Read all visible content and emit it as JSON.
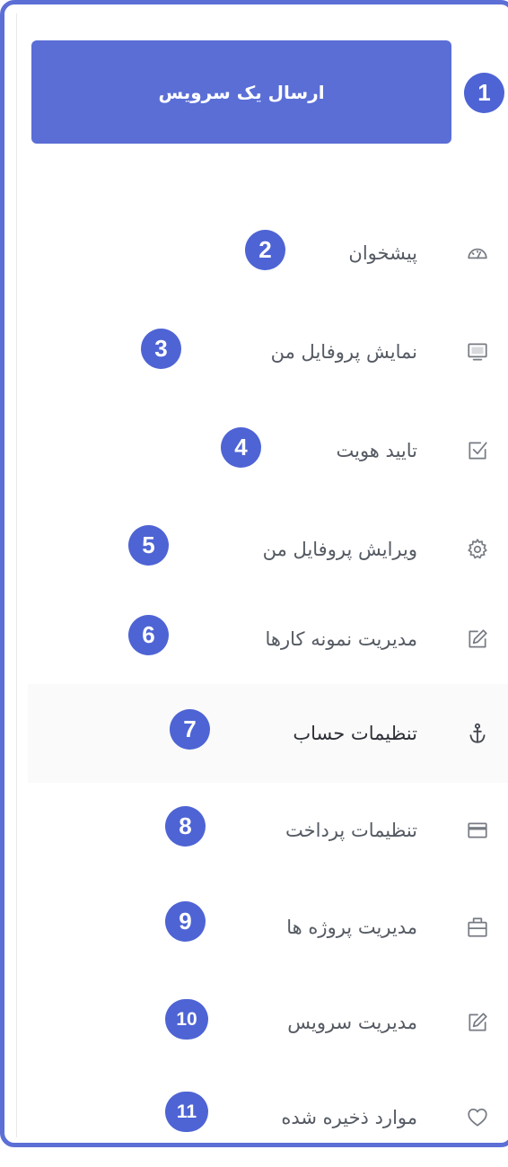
{
  "action_button": {
    "label": "ارسال یک سرویس",
    "badge": "1"
  },
  "menu": [
    {
      "label": "پیشخوان",
      "icon": "dashboard-gauge-icon",
      "badge": "2"
    },
    {
      "label": "نمایش پروفایل من",
      "icon": "monitor-icon",
      "badge": "3"
    },
    {
      "label": "تایید هویت",
      "icon": "checkbox-icon",
      "badge": "4"
    },
    {
      "label": "ویرایش پروفایل من",
      "icon": "gear-icon",
      "badge": "5"
    },
    {
      "label": "مدیریت نمونه کارها",
      "icon": "edit-icon",
      "badge": "6"
    },
    {
      "label": "تنظیمات حساب",
      "icon": "anchor-icon",
      "badge": "7",
      "active": true
    },
    {
      "label": "تنظیمات پرداخت",
      "icon": "credit-card-icon",
      "badge": "8"
    },
    {
      "label": "مدیریت پروژه ها",
      "icon": "briefcase-icon",
      "badge": "9"
    },
    {
      "label": "مدیریت سرویس",
      "icon": "edit-icon",
      "badge": "10"
    },
    {
      "label": "موارد ذخیره شده",
      "icon": "heart-icon",
      "badge": "11"
    }
  ],
  "colors": {
    "accent": "#5a6ed6",
    "badge": "#4e64d4",
    "frame": "#5c6fd6",
    "text": "#555a63",
    "active_row": "#fafafa"
  }
}
